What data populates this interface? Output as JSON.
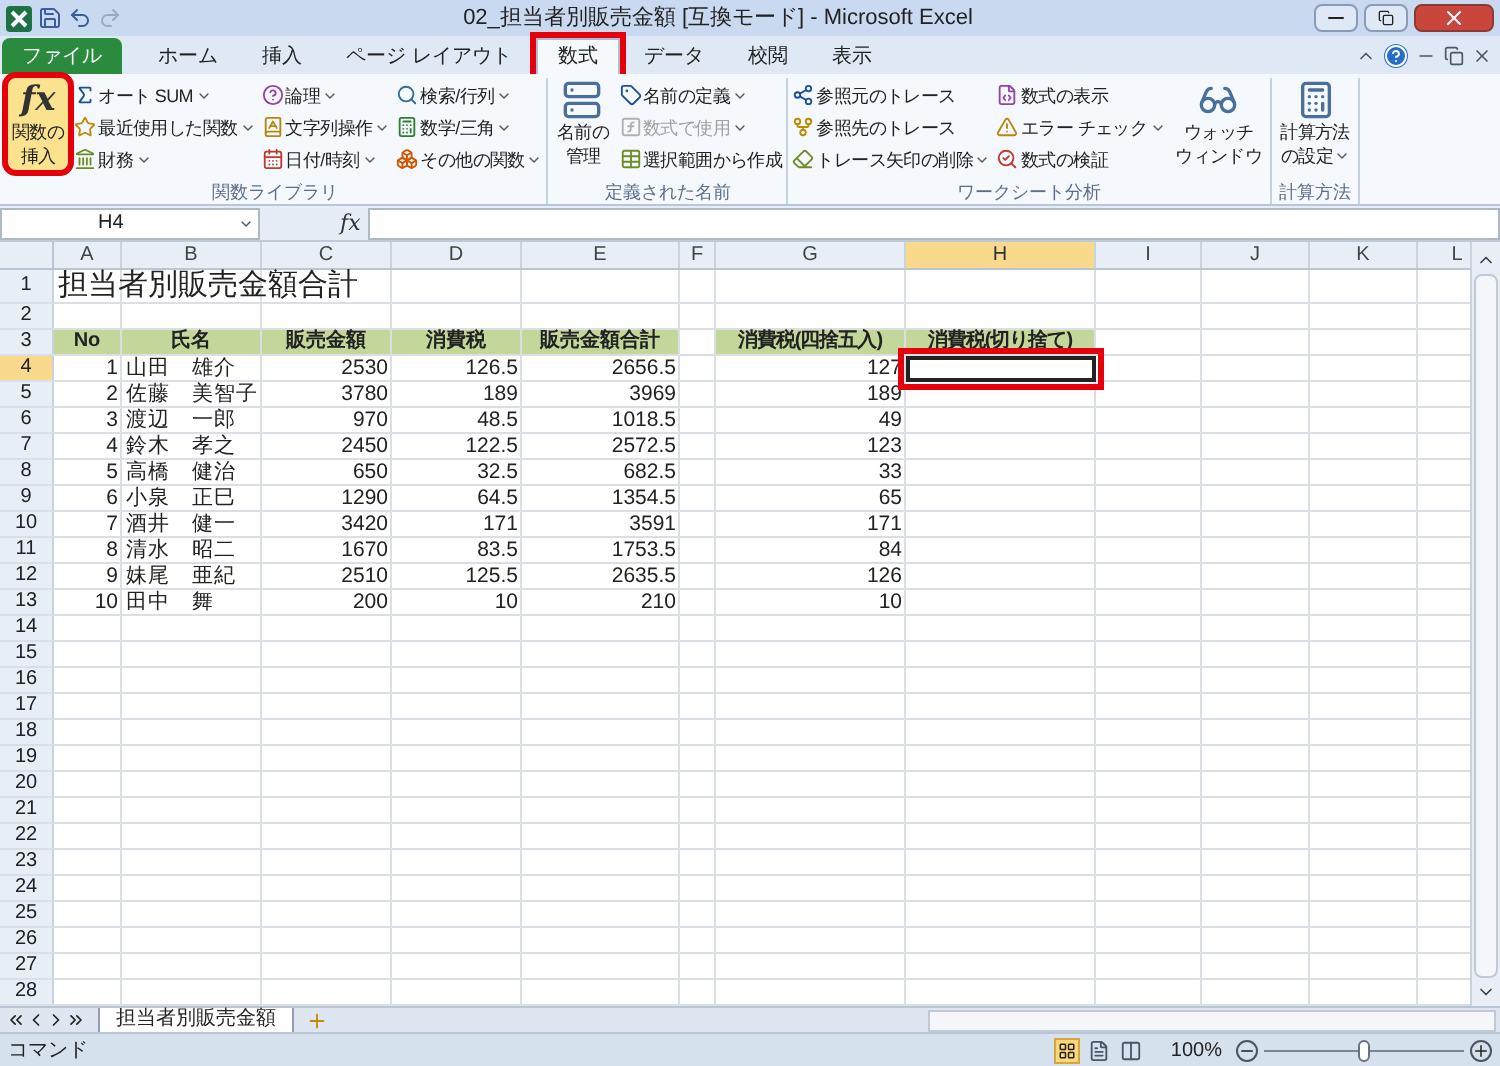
{
  "window": {
    "title": "02_担当者別販売金額 [互換モード] - Microsoft Excel"
  },
  "tabs": [
    {
      "label": "ファイル",
      "kind": "file",
      "selected": false,
      "highlighted": false
    },
    {
      "label": "ホーム",
      "kind": "tab",
      "selected": false,
      "highlighted": false
    },
    {
      "label": "挿入",
      "kind": "tab",
      "selected": false,
      "highlighted": false
    },
    {
      "label": "ページ レイアウト",
      "kind": "tab",
      "selected": false,
      "highlighted": false
    },
    {
      "label": "数式",
      "kind": "tab",
      "selected": true,
      "highlighted": true
    },
    {
      "label": "データ",
      "kind": "tab",
      "selected": false,
      "highlighted": false
    },
    {
      "label": "校閲",
      "kind": "tab",
      "selected": false,
      "highlighted": false
    },
    {
      "label": "表示",
      "kind": "tab",
      "selected": false,
      "highlighted": false
    }
  ],
  "ribbon": {
    "groups": [
      {
        "label": "関数ライブラリ",
        "large": [
          {
            "symbol": "fx",
            "label_lines": [
              "関数の",
              "挿入"
            ],
            "dropdown": false,
            "highlighted": true
          }
        ],
        "small": [
          {
            "label": "オート SUM",
            "dropdown": true,
            "disabled": false
          },
          {
            "label": "最近使用した関数",
            "dropdown": true,
            "disabled": false
          },
          {
            "label": "財務",
            "dropdown": true,
            "disabled": false
          },
          {
            "label": "論理",
            "dropdown": true,
            "disabled": false
          },
          {
            "label": "文字列操作",
            "dropdown": true,
            "disabled": false
          },
          {
            "label": "日付/時刻",
            "dropdown": true,
            "disabled": false
          },
          {
            "label": "検索/行列",
            "dropdown": true,
            "disabled": false
          },
          {
            "label": "数学/三角",
            "dropdown": true,
            "disabled": false
          },
          {
            "label": "その他の関数",
            "dropdown": true,
            "disabled": false
          }
        ]
      },
      {
        "label": "定義された名前",
        "large": [
          {
            "label_lines": [
              "名前の",
              "管理"
            ],
            "dropdown": false,
            "highlighted": false
          }
        ],
        "small": [
          {
            "label": "名前の定義",
            "dropdown": true,
            "disabled": false
          },
          {
            "label": "数式で使用",
            "dropdown": true,
            "disabled": true
          },
          {
            "label": "選択範囲から作成",
            "dropdown": false,
            "disabled": false
          }
        ]
      },
      {
        "label": "ワークシート分析",
        "small": [
          {
            "label": "参照元のトレース",
            "dropdown": false,
            "disabled": false
          },
          {
            "label": "参照先のトレース",
            "dropdown": false,
            "disabled": false
          },
          {
            "label": "トレース矢印の削除",
            "dropdown": true,
            "disabled": false
          },
          {
            "label": "数式の表示",
            "dropdown": false,
            "disabled": false
          },
          {
            "label": "エラー チェック",
            "dropdown": true,
            "disabled": false
          },
          {
            "label": "数式の検証",
            "dropdown": false,
            "disabled": false
          }
        ],
        "large_after": [
          {
            "label_lines": [
              "ウォッチ",
              "ウィンドウ"
            ],
            "dropdown": false,
            "highlighted": false
          }
        ]
      },
      {
        "label": "計算方法",
        "large": [
          {
            "label_lines": [
              "計算方法",
              "の設定"
            ],
            "dropdown": true,
            "highlighted": false
          }
        ]
      }
    ]
  },
  "formula_bar": {
    "name_box": "H4",
    "function_symbol": "fx"
  },
  "sheet": {
    "columns": [
      {
        "label": "A",
        "selected": false
      },
      {
        "label": "B",
        "selected": false
      },
      {
        "label": "C",
        "selected": false
      },
      {
        "label": "D",
        "selected": false
      },
      {
        "label": "E",
        "selected": false
      },
      {
        "label": "F",
        "selected": false
      },
      {
        "label": "G",
        "selected": false
      },
      {
        "label": "H",
        "selected": true
      },
      {
        "label": "I",
        "selected": false
      },
      {
        "label": "J",
        "selected": false
      },
      {
        "label": "K",
        "selected": false
      },
      {
        "label": "L",
        "selected": false
      }
    ],
    "rows": [
      {
        "label": "1",
        "selected": false
      },
      {
        "label": "2",
        "selected": false
      },
      {
        "label": "3",
        "selected": false
      },
      {
        "label": "4",
        "selected": true
      },
      {
        "label": "5",
        "selected": false
      },
      {
        "label": "6",
        "selected": false
      },
      {
        "label": "7",
        "selected": false
      },
      {
        "label": "8",
        "selected": false
      },
      {
        "label": "9",
        "selected": false
      },
      {
        "label": "10",
        "selected": false
      },
      {
        "label": "11",
        "selected": false
      },
      {
        "label": "12",
        "selected": false
      },
      {
        "label": "13",
        "selected": false
      },
      {
        "label": "14",
        "selected": false
      },
      {
        "label": "15",
        "selected": false
      },
      {
        "label": "16",
        "selected": false
      },
      {
        "label": "17",
        "selected": false
      },
      {
        "label": "18",
        "selected": false
      },
      {
        "label": "19",
        "selected": false
      },
      {
        "label": "20",
        "selected": false
      },
      {
        "label": "21",
        "selected": false
      },
      {
        "label": "22",
        "selected": false
      },
      {
        "label": "23",
        "selected": false
      },
      {
        "label": "24",
        "selected": false
      },
      {
        "label": "25",
        "selected": false
      },
      {
        "label": "26",
        "selected": false
      },
      {
        "label": "27",
        "selected": false
      },
      {
        "label": "28",
        "selected": false
      }
    ],
    "title": "担当者別販売金額合計",
    "header": {
      "no": "No",
      "name": "氏名",
      "sales": "販売金額",
      "tax": "消費税",
      "total": "販売金額合計",
      "tax_rounded": "消費税(四捨五入)",
      "tax_truncated": "消費税(切り捨て)"
    },
    "data": [
      {
        "no": "1",
        "name": "山田　雄介",
        "sales": "2530",
        "tax": "126.5",
        "total": "2656.5",
        "tax_rounded": "127"
      },
      {
        "no": "2",
        "name": "佐藤　美智子",
        "sales": "3780",
        "tax": "189",
        "total": "3969",
        "tax_rounded": "189"
      },
      {
        "no": "3",
        "name": "渡辺　一郎",
        "sales": "970",
        "tax": "48.5",
        "total": "1018.5",
        "tax_rounded": "49"
      },
      {
        "no": "4",
        "name": "鈴木　孝之",
        "sales": "2450",
        "tax": "122.5",
        "total": "2572.5",
        "tax_rounded": "123"
      },
      {
        "no": "5",
        "name": "高橋　健治",
        "sales": "650",
        "tax": "32.5",
        "total": "682.5",
        "tax_rounded": "33"
      },
      {
        "no": "6",
        "name": "小泉　正巳",
        "sales": "1290",
        "tax": "64.5",
        "total": "1354.5",
        "tax_rounded": "65"
      },
      {
        "no": "7",
        "name": "酒井　健一",
        "sales": "3420",
        "tax": "171",
        "total": "3591",
        "tax_rounded": "171"
      },
      {
        "no": "8",
        "name": "清水　昭二",
        "sales": "1670",
        "tax": "83.5",
        "total": "1753.5",
        "tax_rounded": "84"
      },
      {
        "no": "9",
        "name": "妹尾　亜紀",
        "sales": "2510",
        "tax": "125.5",
        "total": "2635.5",
        "tax_rounded": "126"
      },
      {
        "no": "10",
        "name": "田中　舞",
        "sales": "200",
        "tax": "10",
        "total": "210",
        "tax_rounded": "10"
      }
    ],
    "active_cell_highlighted": true
  },
  "sheet_tabs": [
    {
      "label": "担当者別販売金額",
      "selected": true
    }
  ],
  "status_bar": {
    "mode": "コマンド",
    "views": [
      {
        "selected": true
      },
      {
        "selected": false
      },
      {
        "selected": false
      }
    ],
    "zoom": "100%",
    "zoom_level": {
      "level": 0.5
    }
  }
}
